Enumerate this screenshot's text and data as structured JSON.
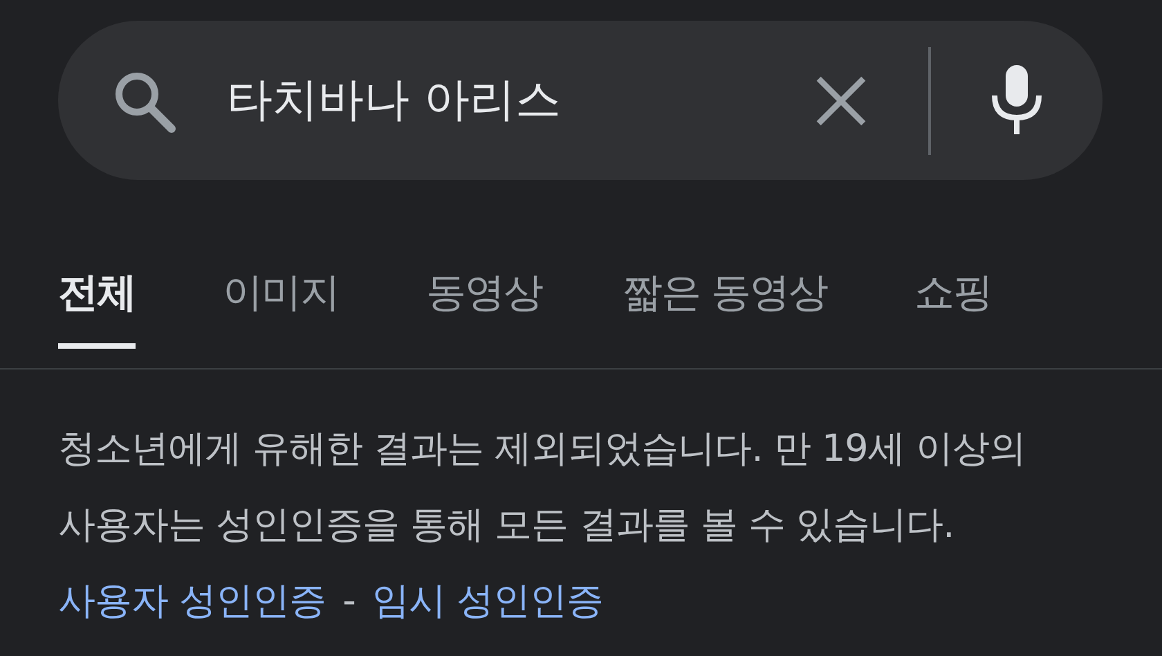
{
  "search": {
    "value": "타치바나 아리스"
  },
  "tabs": [
    {
      "label": "전체",
      "selected": true
    },
    {
      "label": "이미지",
      "selected": false
    },
    {
      "label": "동영상",
      "selected": false
    },
    {
      "label": "짧은 동영상",
      "selected": false
    },
    {
      "label": "쇼핑",
      "selected": false
    }
  ],
  "notice": {
    "text": "청소년에게 유해한 결과는 제외되었습니다. 만 19세 이상의 사용자는 성인인증을 통해 모든 결과를 볼 수 있습니다.",
    "links": [
      "사용자 성인인증",
      "임시 성인인증"
    ],
    "separator": "-"
  }
}
